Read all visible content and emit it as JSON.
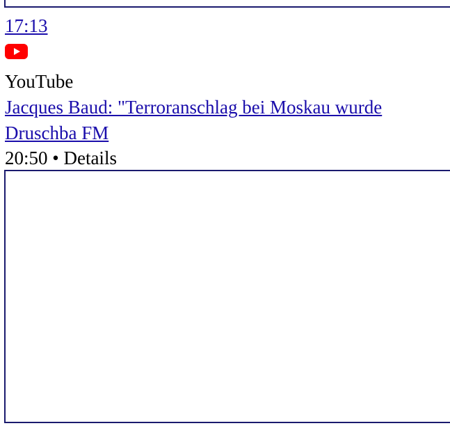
{
  "item_top": {
    "duration": "17:13",
    "source_name": "YouTube",
    "source_icon": "youtube-icon",
    "brand_color": "#ff0000"
  },
  "item_main": {
    "title": "Jacques Baud: \"Terroranschlag bei Moskau wurde",
    "channel": "Druschba FM",
    "duration": "20:50",
    "separator": "•",
    "details_label": "Details"
  }
}
